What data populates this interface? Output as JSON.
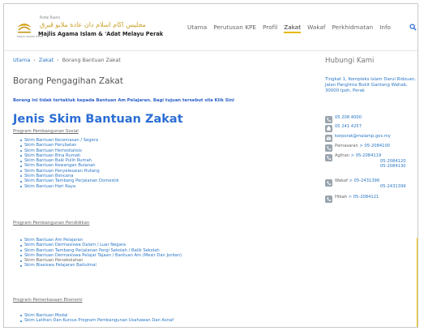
{
  "header": {
    "logo_portal": "Portal Rasmi",
    "logo_arabic": "مجليس اڬام اسلام دان عادة ملايو ڤيرق",
    "logo_name": "Majlis Agama Islam & 'Adat Melayu Perak",
    "logo_sub": "MAJLIS AGAMA ISLAM",
    "nav": [
      "Utama",
      "Perutusan KPE",
      "Profil",
      "Zakat",
      "Wakaf",
      "Perkhidmatan",
      "Info"
    ],
    "active_nav": "Zakat",
    "accent_color": "#e6b800",
    "search_icon": "search-icon"
  },
  "breadcrumb": [
    "Utama",
    "Zakat",
    "Borang Bantuan Zakat"
  ],
  "page_title": "Borang Pengagihan Zakat",
  "notice": "Borang ini tidak tertakluk kepada Bantuan Am Pelajaran. Bagi tujuan tersebut sila Klik Sini",
  "section_title": "Jenis Skim Bantuan Zakat",
  "programs": [
    {
      "title": "Program Pembangunan Sosial",
      "items": [
        "Skim Bantuan Kecemasan / Segera",
        "Skim Bantuan Perubatan",
        "Skim Bantuan Hemodialisis",
        "Skim Bantuan Bina Rumah",
        "Skim Bantuan Baik Pulih Rumah",
        "Skim Bantuan Kewangan Bulanan",
        "Skim Bantuan Penyelesaian Hutang",
        "Skim Bantuan Bencana",
        "Skim Bantuan Tambang Perjalanan Domestik",
        "Skim Bantuan Hari Raya"
      ]
    },
    {
      "title": "Program Pembangunan Pendidikan",
      "items": [
        "Skim Bantuan Am Pelajaran",
        "Skim Bantuan Dermasiswa Dalam / Luar Negara",
        "Skim Bantuan Tambang Perjalanan Pergi Sekolah / Balik Sekolah",
        "Skim Bantuan Dermasiswa Pelajar Tajaan / Bantuan Am (Mesir Dan Jordan)",
        "Skim Bantuan Persekolahan",
        "Skim Biasiswa Pelajaran Baitulmal"
      ]
    },
    {
      "title": "Program Pemerkasaan Ekonomi",
      "items": [
        "Skim Bantuan Modal",
        "Skim Latihan Dan Kursus Program Pembangunan Usahawan Dan Asnaf"
      ]
    }
  ],
  "sidebar": {
    "title": "Hubungi Kami",
    "address": "Tingkat 1, Kompleks Islam Darul Ridzuan, Jalan Panglima Bukit Gantang Wahab, 30000 Ipoh, Perak",
    "phone": "05 208 4000",
    "fax": "05 241 4257",
    "email": "korporat@maiamp.gov.my",
    "pemasaran_label": "Pemasaran",
    "pemasaran": "> 05-2084100",
    "agihan_label": "Agihan",
    "agihan": [
      "> 05-2084119",
      "05-2084120",
      "05-2084130"
    ],
    "wakaf_label": "Wakaf",
    "wakaf": [
      "> 05-2431396",
      "05-2431399"
    ],
    "hibah_label": "Hibah",
    "hibah": "> 05-2084121"
  }
}
